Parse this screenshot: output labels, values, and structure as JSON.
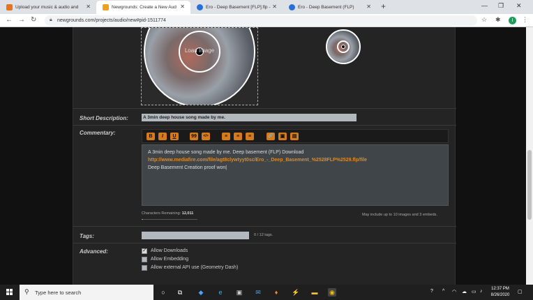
{
  "browser": {
    "tabs": [
      {
        "title": "Upload your music & audio and",
        "favicon_color": "#e8731c",
        "active": false
      },
      {
        "title": "Newgrounds: Create a New Aud",
        "favicon_color": "#f0a020",
        "active": true
      },
      {
        "title": "Ero - Deep Basement [FLP].flp - ",
        "favicon_color": "#2a6fd6",
        "active": false
      },
      {
        "title": "Ero - Deep Basement (FLP)",
        "favicon_color": "#2a6fd6",
        "active": false
      }
    ],
    "url": "newgrounds.com/projects/audio/new#pid-1511774",
    "avatar_letter": "I"
  },
  "form": {
    "upload_image_label": "Load Image",
    "short_description": {
      "label": "Short Description:",
      "value": "A 3min deep house song made by me."
    },
    "commentary": {
      "label": "Commentary:",
      "toolbar": [
        "B",
        "I",
        "U",
        "99",
        "</>",
        "≡",
        "≡",
        "≡",
        "🔗",
        "▣",
        "▤"
      ],
      "line1": "A 3min deep house song made by me. Deep basement (FLP) Download",
      "link": "http://www.mediafire.com/file/agt8clywtyyt0sc/Ero_-_Deep_Basement_%2528FLP%2529.flp/file",
      "line3": "Deep Basement Creation proof won|"
    },
    "characters_remaining_label": "Characters Remaining:",
    "characters_remaining_value": "12,011",
    "characters_used_fraction": 0.02,
    "image_note": "May include up to 10 images and 3 embeds.",
    "tags": {
      "label": "Tags:",
      "count": "0 / 12 tags."
    },
    "advanced": {
      "label": "Advanced:",
      "options": [
        {
          "label": "Allow Downloads",
          "checked": true
        },
        {
          "label": "Allow Embedding",
          "checked": false
        },
        {
          "label": "Allow external API use (Geometry Dash)",
          "checked": false
        }
      ]
    }
  },
  "taskbar": {
    "search_placeholder": "Type here to search",
    "time": "12:37 PM",
    "date": "8/26/2020"
  }
}
